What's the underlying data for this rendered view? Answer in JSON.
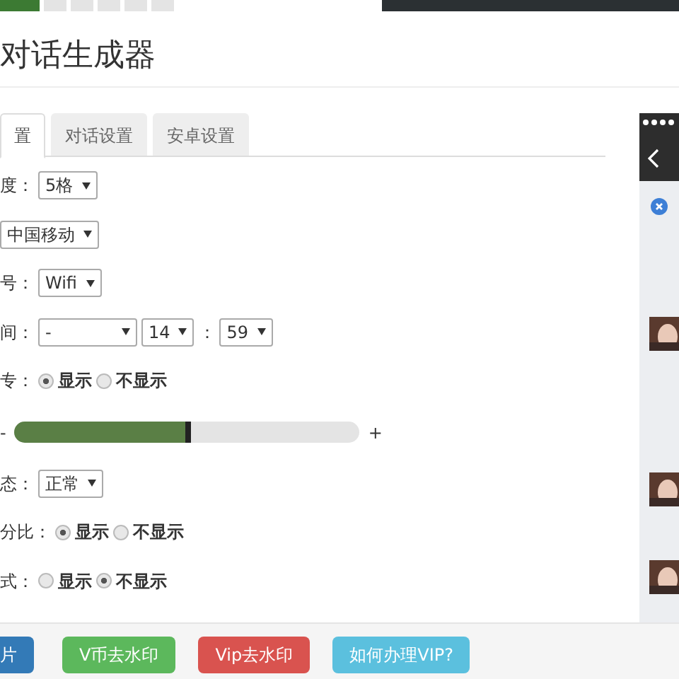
{
  "title": "对话生成器",
  "tabs": [
    {
      "label": "置",
      "selected": true
    },
    {
      "label": "对话设置",
      "selected": false
    },
    {
      "label": "安卓设置",
      "selected": false
    }
  ],
  "form": [
    {
      "kind": "select",
      "label": "度：",
      "selects": [
        "5格"
      ]
    },
    {
      "kind": "select",
      "selects": [
        "中国移动"
      ]
    },
    {
      "kind": "select",
      "label": "号：",
      "selects": [
        "Wifi"
      ]
    },
    {
      "kind": "time",
      "label": "间：",
      "selects": [
        "-",
        "14",
        "59"
      ],
      "separator": "："
    },
    {
      "kind": "radio",
      "label": "专：",
      "options": [
        {
          "label": "显示",
          "selected": true
        },
        {
          "label": "不显示",
          "selected": false
        }
      ]
    },
    {
      "kind": "slider",
      "minus": "-",
      "plus": "+",
      "level": 0.51
    },
    {
      "kind": "select",
      "label": "态：",
      "selects": [
        "正常"
      ]
    },
    {
      "kind": "radio",
      "label": "分比：",
      "options": [
        {
          "label": "显示",
          "selected": true
        },
        {
          "label": "不显示",
          "selected": false
        }
      ]
    },
    {
      "kind": "radio",
      "label": "式：",
      "options": [
        {
          "label": "显示",
          "selected": false
        },
        {
          "label": "不显示",
          "selected": true
        }
      ]
    }
  ],
  "buttons": [
    {
      "label": "片",
      "color": "#337ab7"
    },
    {
      "label": "V币去水印",
      "color": "#5cb85c"
    },
    {
      "label": "Vip去水印",
      "color": "#d9534f"
    },
    {
      "label": "如何办理VIP?",
      "color": "#5bc0de"
    }
  ]
}
